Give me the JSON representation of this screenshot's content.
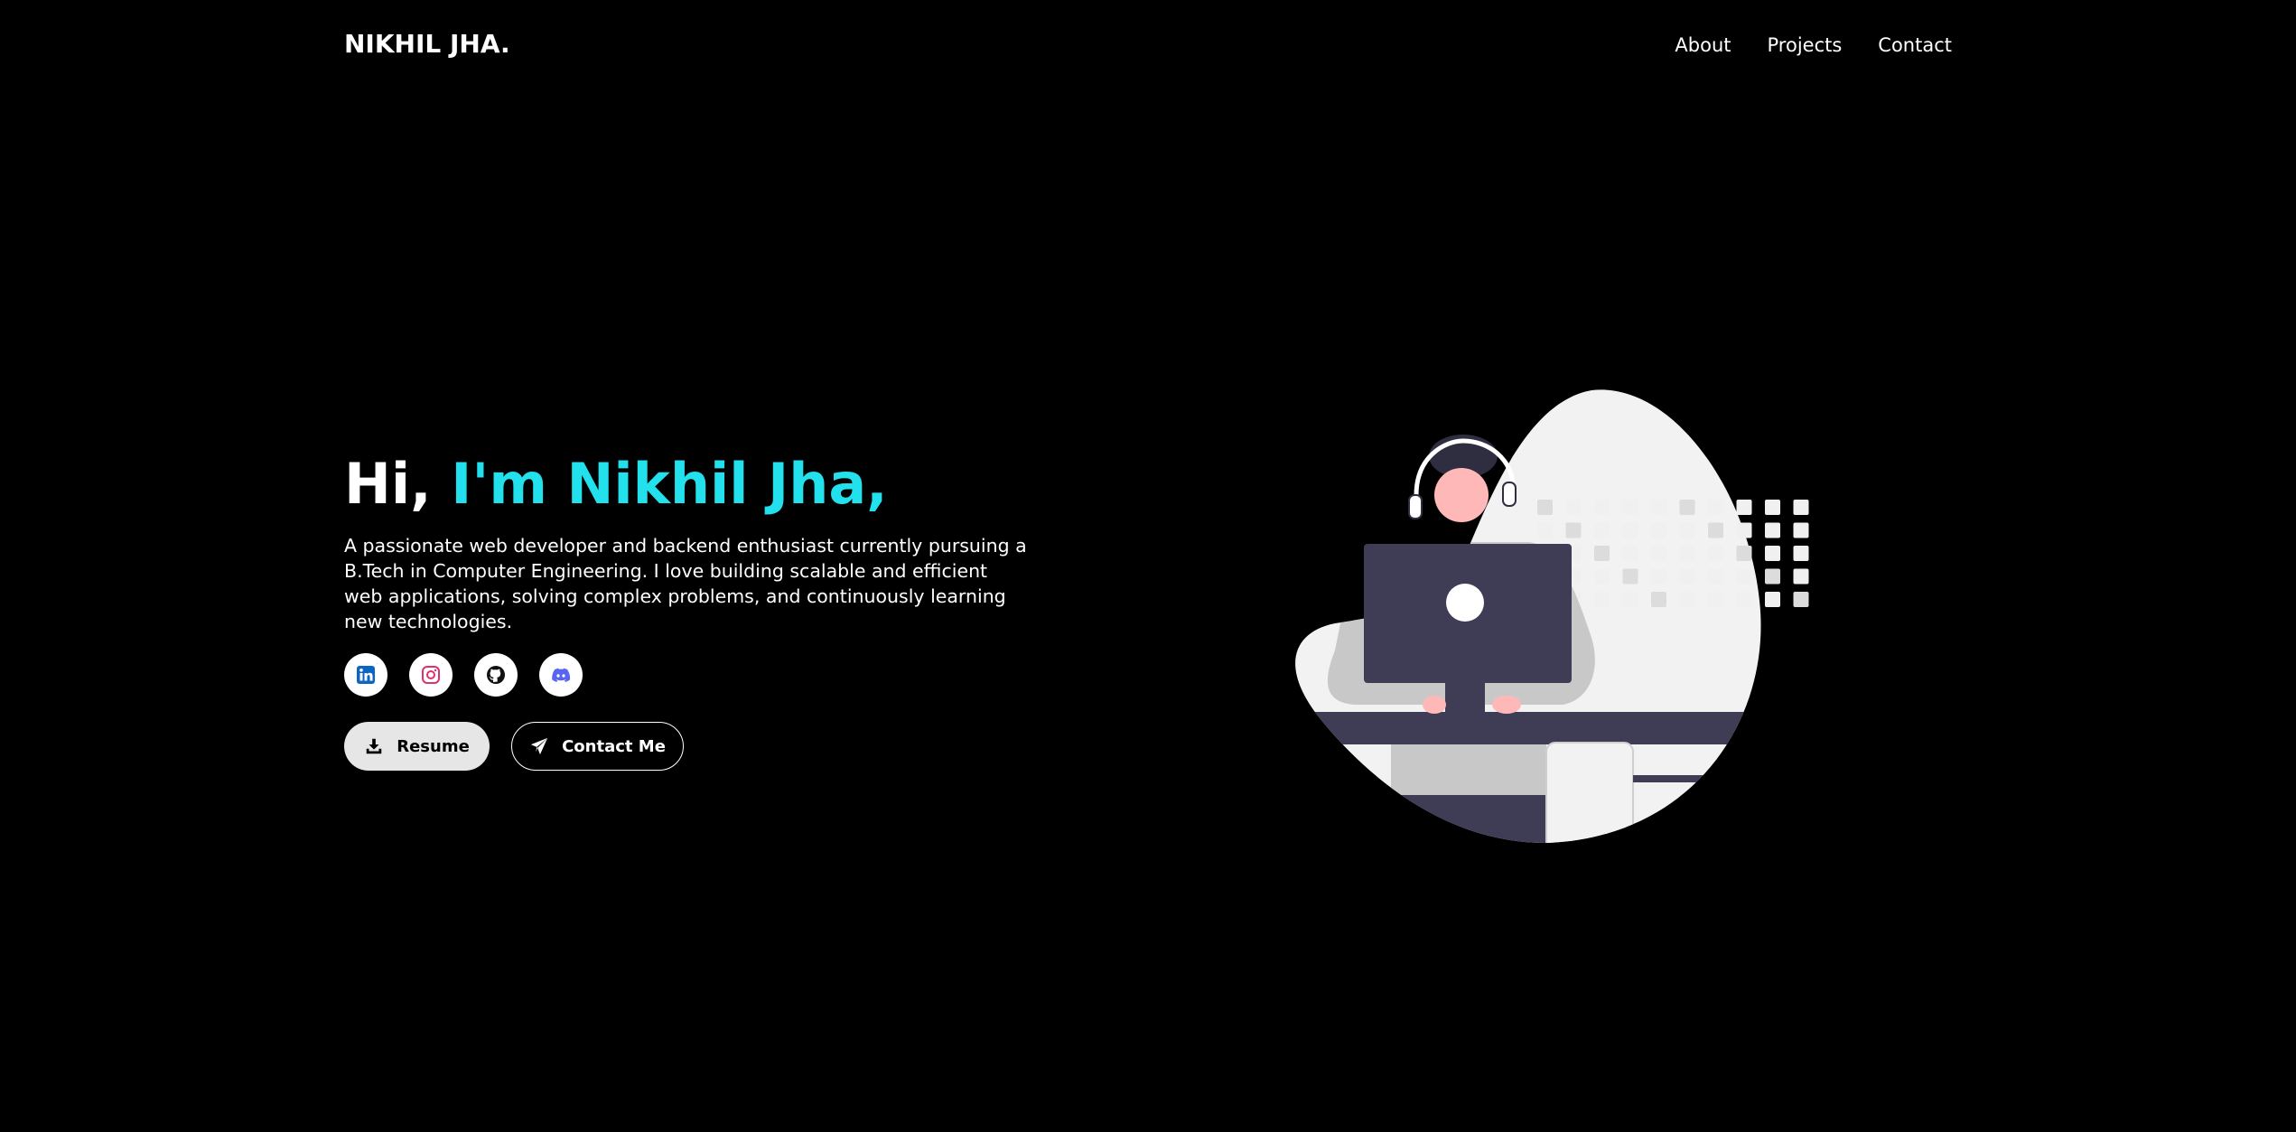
{
  "header": {
    "logo": "NIKHIL JHA.",
    "nav": [
      {
        "label": "About"
      },
      {
        "label": "Projects"
      },
      {
        "label": "Contact"
      }
    ]
  },
  "hero": {
    "greeting": "Hi,",
    "name": "I'm Nikhil Jha,",
    "description": "A passionate web developer and backend enthusiast currently pursuing a B.Tech in Computer Engineering. I love building scalable and efficient web applications, solving complex problems, and continuously learning new technologies."
  },
  "socials": [
    {
      "icon": "linkedin-icon",
      "color": "#0a66c2"
    },
    {
      "icon": "instagram-icon",
      "color": "#e1306c"
    },
    {
      "icon": "github-icon",
      "color": "#000000"
    },
    {
      "icon": "discord-icon",
      "color": "#5865f2"
    }
  ],
  "buttons": {
    "resume_label": "Resume",
    "contact_label": "Contact Me"
  },
  "colors": {
    "background": "#000000",
    "accent": "#22e0ec",
    "text": "#ffffff"
  }
}
